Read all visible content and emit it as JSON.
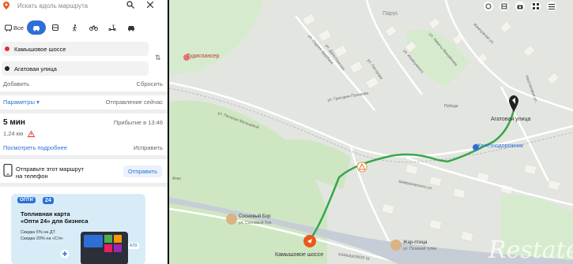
{
  "search": {
    "placeholder": "Искать вдоль маршрута"
  },
  "modes": [
    {
      "name": "all",
      "label": "Все"
    },
    {
      "name": "car"
    },
    {
      "name": "bus"
    },
    {
      "name": "walk"
    },
    {
      "name": "bike"
    },
    {
      "name": "scooter"
    },
    {
      "name": "taxi"
    }
  ],
  "route": {
    "from": "Камышовое шоссе",
    "to": "Агатовая улица",
    "add_label": "Добавить",
    "reset_label": "Сбросить",
    "params_label": "Параметры",
    "departure_label": "Отправление сейчас"
  },
  "result": {
    "time": "5 мин",
    "arrival": "Прибытие в 13:46",
    "distance": "1,24 км",
    "details_label": "Посмотреть подробнее",
    "edit_label": "Исправить"
  },
  "send": {
    "text_line1": "Отправьте этот маршрут",
    "text_line2": "на телефон",
    "button": "Отправить"
  },
  "ad": {
    "logo_small": "ОПТИ",
    "logo_big": "24",
    "title_line1": "Топливная карта",
    "title_line2": "«Опти 24» для бизнеса",
    "line1": "Скидка 5% на ДТ",
    "line2": "Скидка 20% на «Сті»",
    "badge": "АЛ3"
  },
  "map": {
    "labels": {
      "parus": "Парус",
      "agatovaya": "Агатовая улица",
      "zheleznodorozhnaya": "Железнодорожник",
      "tuddisnaser": "Тудиспансер",
      "sosnovy_bor": "Сосновый Бор",
      "sosnovy_bor_sub": "ул. Сосновый бор",
      "zhar_ptitsa": "Жар-птица",
      "zhar_ptitsa_sub": "ул. Полевой тупик",
      "kamyshovoe": "Камышовое шоссе",
      "kamyshovoe_street": "КАМЫШОВОЕ Ш.",
      "pobeda": "Победа",
      "atan": "Атан",
      "watermark": "Restate"
    },
    "streets": {
      "s1": "ул. Пелагеи Мальцевой",
      "s2": "ул. Григория Полякова",
      "s3": "ул. Сергея Щербака",
      "s4": "Шаврановского ул.",
      "s5": "ул. Дагестанская",
      "s6": "ул. Жемчужного",
      "s7": "Каштановая ул.",
      "s8": "ул. Пестрова",
      "s9": "ул. Никиты Михайлова",
      "s10": "Жемчужная ул."
    }
  },
  "colors": {
    "accent": "#2d6fd6",
    "route": "#37a64a",
    "pin": "#e8591c"
  }
}
